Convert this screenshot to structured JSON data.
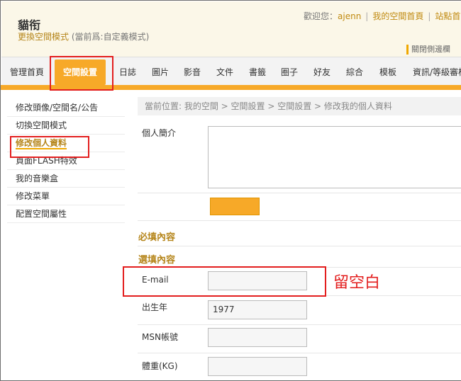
{
  "header": {
    "site_title": "貓衔",
    "mode_link": "更換空間模式",
    "mode_current": "(當前爲:自定義模式)",
    "welcome": "歡迎您：",
    "username": "ajenn",
    "my_space_home": "我的空間首頁",
    "site_home": "站點首頁",
    "close_sidebar": "關閉側邊欄"
  },
  "nav": {
    "tabs": [
      "管理首頁",
      "空間設置",
      "日誌",
      "圖片",
      "影音",
      "文件",
      "書籤",
      "圈子",
      "好友",
      "綜合",
      "模板",
      "資訊/等級審核"
    ],
    "active_index": 1
  },
  "sidebar": {
    "items": [
      "修改頭像/空間名/公告",
      "切換空間模式",
      "修改個人資料",
      "頁面FLASH特效",
      "我的音樂盒",
      "修改菜單",
      "配置空間屬性"
    ],
    "active_index": 2
  },
  "main": {
    "breadcrumb": "當前位置: 我的空間 > 空間設置 > 空間設置 > 修改我的個人資料",
    "bio_label": "個人簡介",
    "required_heading": "必填內容",
    "optional_heading": "選填內容",
    "email_label": "E-mail",
    "email_value": "",
    "birth_year_label": "出生年",
    "birth_year_value": "1977",
    "msn_label": "MSN帳號",
    "msn_value": "",
    "weight_label": "體重(KG)",
    "weight_value": ""
  },
  "annotation": {
    "note": "留空白"
  },
  "colors": {
    "accent": "#f7a928",
    "link": "#b5851a",
    "highlight_box": "#e31e1e"
  }
}
